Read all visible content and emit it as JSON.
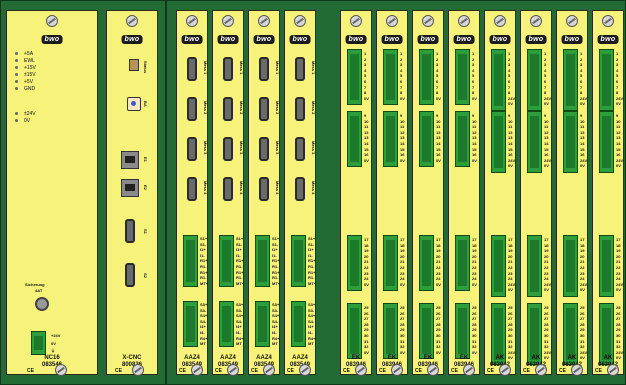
{
  "modules": [
    {
      "id": "nc16",
      "title": "NC16",
      "code": "083546"
    },
    {
      "id": "xcnc",
      "title": "X-CNC",
      "code": "800836"
    },
    {
      "id": "aaz4_1",
      "title": "AAZ4",
      "code": "083549"
    },
    {
      "id": "aaz4_2",
      "title": "AAZ4",
      "code": "083549"
    },
    {
      "id": "aaz4_3",
      "title": "AAZ4",
      "code": "083549"
    },
    {
      "id": "aaz4_4",
      "title": "AAZ4",
      "code": "083549"
    },
    {
      "id": "ek_1",
      "title": "EK",
      "code": "083946"
    },
    {
      "id": "ek_2",
      "title": "EK",
      "code": "083946"
    },
    {
      "id": "ek_3",
      "title": "EK",
      "code": "083946"
    },
    {
      "id": "ek_4",
      "title": "EK",
      "code": "083946"
    },
    {
      "id": "ak_1",
      "title": "AK",
      "code": "083942"
    },
    {
      "id": "ak_2",
      "title": "AK",
      "code": "083942"
    },
    {
      "id": "ak_3",
      "title": "AK",
      "code": "083942"
    },
    {
      "id": "ak_4",
      "title": "AK",
      "code": "083942"
    }
  ],
  "brand": "bwo",
  "ce_mark": "CE",
  "nc16": {
    "leds": [
      "+5A",
      "EWL",
      "+15V",
      "±15V",
      "+5V",
      "GND"
    ],
    "leds2": [
      "±24V",
      "0V"
    ],
    "fuse_label": "Sicherung",
    "fuse_value": "4AT",
    "power_labels": [
      "+24V",
      "0V",
      "⏚"
    ]
  },
  "xcnc": {
    "status": "Status",
    "ba": "BA",
    "ports": [
      "E1",
      "E2",
      "S1",
      "S2"
    ]
  },
  "aaz4": {
    "ports": [
      "Mess 1",
      "Mess 2",
      "Mess 3",
      "Mess 4"
    ],
    "term1": [
      "S1+",
      "S1-",
      "I1+",
      "I1-",
      "R1+",
      "R1-",
      "R1+",
      "R1-",
      "MT+"
    ],
    "term2": [
      "S3+",
      "S3-",
      "S4+",
      "S4-",
      "I4+",
      "I4-",
      "R4+",
      "MT"
    ]
  },
  "ek": {
    "block1": [
      "1",
      "2",
      "3",
      "4",
      "5",
      "6",
      "7",
      "8",
      "0V"
    ],
    "block2": [
      "9",
      "10",
      "11",
      "12",
      "13",
      "14",
      "15",
      "16",
      "0V"
    ],
    "block3": [
      "17",
      "18",
      "19",
      "20",
      "21",
      "22",
      "23",
      "24",
      "0V"
    ],
    "block4": [
      "25",
      "26",
      "27",
      "28",
      "29",
      "30",
      "31",
      "32",
      "0V"
    ]
  },
  "ak": {
    "block1": [
      "1",
      "2",
      "3",
      "4",
      "5",
      "6",
      "7",
      "8",
      "24V",
      "0V"
    ],
    "block2": [
      "9",
      "10",
      "11",
      "12",
      "13",
      "14",
      "15",
      "16",
      "24V",
      "0V"
    ],
    "block3": [
      "17",
      "18",
      "19",
      "20",
      "21",
      "22",
      "23",
      "24",
      "24V",
      "0V"
    ],
    "block4": [
      "25",
      "26",
      "27",
      "28",
      "29",
      "30",
      "31",
      "32",
      "24V",
      "0V"
    ]
  }
}
